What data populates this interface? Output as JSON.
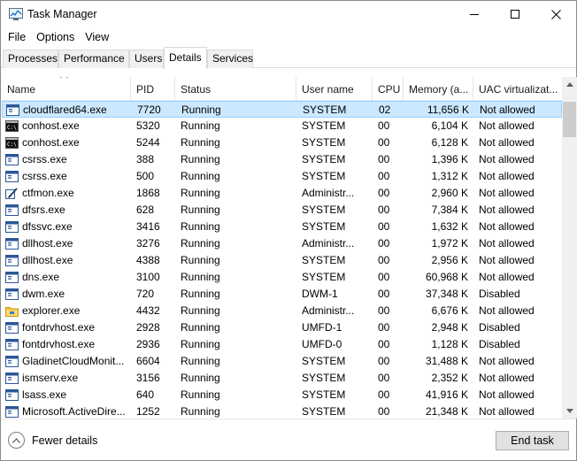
{
  "window": {
    "title": "Task Manager"
  },
  "menu": {
    "items": [
      "File",
      "Options",
      "View"
    ]
  },
  "tabs": [
    "Processes",
    "Performance",
    "Users",
    "Details",
    "Services"
  ],
  "active_tab": "Details",
  "columns": [
    "Name",
    "PID",
    "Status",
    "User name",
    "CPU",
    "Memory (a...",
    "UAC virtualizat..."
  ],
  "rows": [
    {
      "name": "cloudflared64.exe",
      "pid": "7720",
      "status": "Running",
      "user": "SYSTEM",
      "cpu": "02",
      "memory": "11,656 K",
      "uac": "Not allowed",
      "icon": "app-window-icon",
      "selected": true
    },
    {
      "name": "conhost.exe",
      "pid": "5320",
      "status": "Running",
      "user": "SYSTEM",
      "cpu": "00",
      "memory": "6,104 K",
      "uac": "Not allowed",
      "icon": "console-icon"
    },
    {
      "name": "conhost.exe",
      "pid": "5244",
      "status": "Running",
      "user": "SYSTEM",
      "cpu": "00",
      "memory": "6,128 K",
      "uac": "Not allowed",
      "icon": "console-icon"
    },
    {
      "name": "csrss.exe",
      "pid": "388",
      "status": "Running",
      "user": "SYSTEM",
      "cpu": "00",
      "memory": "1,396 K",
      "uac": "Not allowed",
      "icon": "app-window-icon"
    },
    {
      "name": "csrss.exe",
      "pid": "500",
      "status": "Running",
      "user": "SYSTEM",
      "cpu": "00",
      "memory": "1,312 K",
      "uac": "Not allowed",
      "icon": "app-window-icon"
    },
    {
      "name": "ctfmon.exe",
      "pid": "1868",
      "status": "Running",
      "user": "Administr...",
      "cpu": "00",
      "memory": "2,960 K",
      "uac": "Not allowed",
      "icon": "pen-icon"
    },
    {
      "name": "dfsrs.exe",
      "pid": "628",
      "status": "Running",
      "user": "SYSTEM",
      "cpu": "00",
      "memory": "7,384 K",
      "uac": "Not allowed",
      "icon": "app-window-icon"
    },
    {
      "name": "dfssvc.exe",
      "pid": "3416",
      "status": "Running",
      "user": "SYSTEM",
      "cpu": "00",
      "memory": "1,632 K",
      "uac": "Not allowed",
      "icon": "app-window-icon"
    },
    {
      "name": "dllhost.exe",
      "pid": "3276",
      "status": "Running",
      "user": "Administr...",
      "cpu": "00",
      "memory": "1,972 K",
      "uac": "Not allowed",
      "icon": "app-window-icon"
    },
    {
      "name": "dllhost.exe",
      "pid": "4388",
      "status": "Running",
      "user": "SYSTEM",
      "cpu": "00",
      "memory": "2,956 K",
      "uac": "Not allowed",
      "icon": "app-window-icon"
    },
    {
      "name": "dns.exe",
      "pid": "3100",
      "status": "Running",
      "user": "SYSTEM",
      "cpu": "00",
      "memory": "60,968 K",
      "uac": "Not allowed",
      "icon": "app-window-icon"
    },
    {
      "name": "dwm.exe",
      "pid": "720",
      "status": "Running",
      "user": "DWM-1",
      "cpu": "00",
      "memory": "37,348 K",
      "uac": "Disabled",
      "icon": "app-window-icon"
    },
    {
      "name": "explorer.exe",
      "pid": "4432",
      "status": "Running",
      "user": "Administr...",
      "cpu": "00",
      "memory": "6,676 K",
      "uac": "Not allowed",
      "icon": "folder-icon"
    },
    {
      "name": "fontdrvhost.exe",
      "pid": "2928",
      "status": "Running",
      "user": "UMFD-1",
      "cpu": "00",
      "memory": "2,948 K",
      "uac": "Disabled",
      "icon": "app-window-icon"
    },
    {
      "name": "fontdrvhost.exe",
      "pid": "2936",
      "status": "Running",
      "user": "UMFD-0",
      "cpu": "00",
      "memory": "1,128 K",
      "uac": "Disabled",
      "icon": "app-window-icon"
    },
    {
      "name": "GladinetCloudMonit...",
      "pid": "6604",
      "status": "Running",
      "user": "SYSTEM",
      "cpu": "00",
      "memory": "31,488 K",
      "uac": "Not allowed",
      "icon": "app-window-icon"
    },
    {
      "name": "ismserv.exe",
      "pid": "3156",
      "status": "Running",
      "user": "SYSTEM",
      "cpu": "00",
      "memory": "2,352 K",
      "uac": "Not allowed",
      "icon": "app-window-icon"
    },
    {
      "name": "lsass.exe",
      "pid": "640",
      "status": "Running",
      "user": "SYSTEM",
      "cpu": "00",
      "memory": "41,916 K",
      "uac": "Not allowed",
      "icon": "app-window-icon"
    },
    {
      "name": "Microsoft.ActiveDire...",
      "pid": "1252",
      "status": "Running",
      "user": "SYSTEM",
      "cpu": "00",
      "memory": "21,348 K",
      "uac": "Not allowed",
      "icon": "app-window-icon"
    }
  ],
  "footer": {
    "fewer_details": "Fewer details",
    "end_task": "End task"
  },
  "colors": {
    "selected_bg": "#cce8ff",
    "selected_border": "#99d1ff",
    "title_icon_blue": "#1a6fc9"
  }
}
